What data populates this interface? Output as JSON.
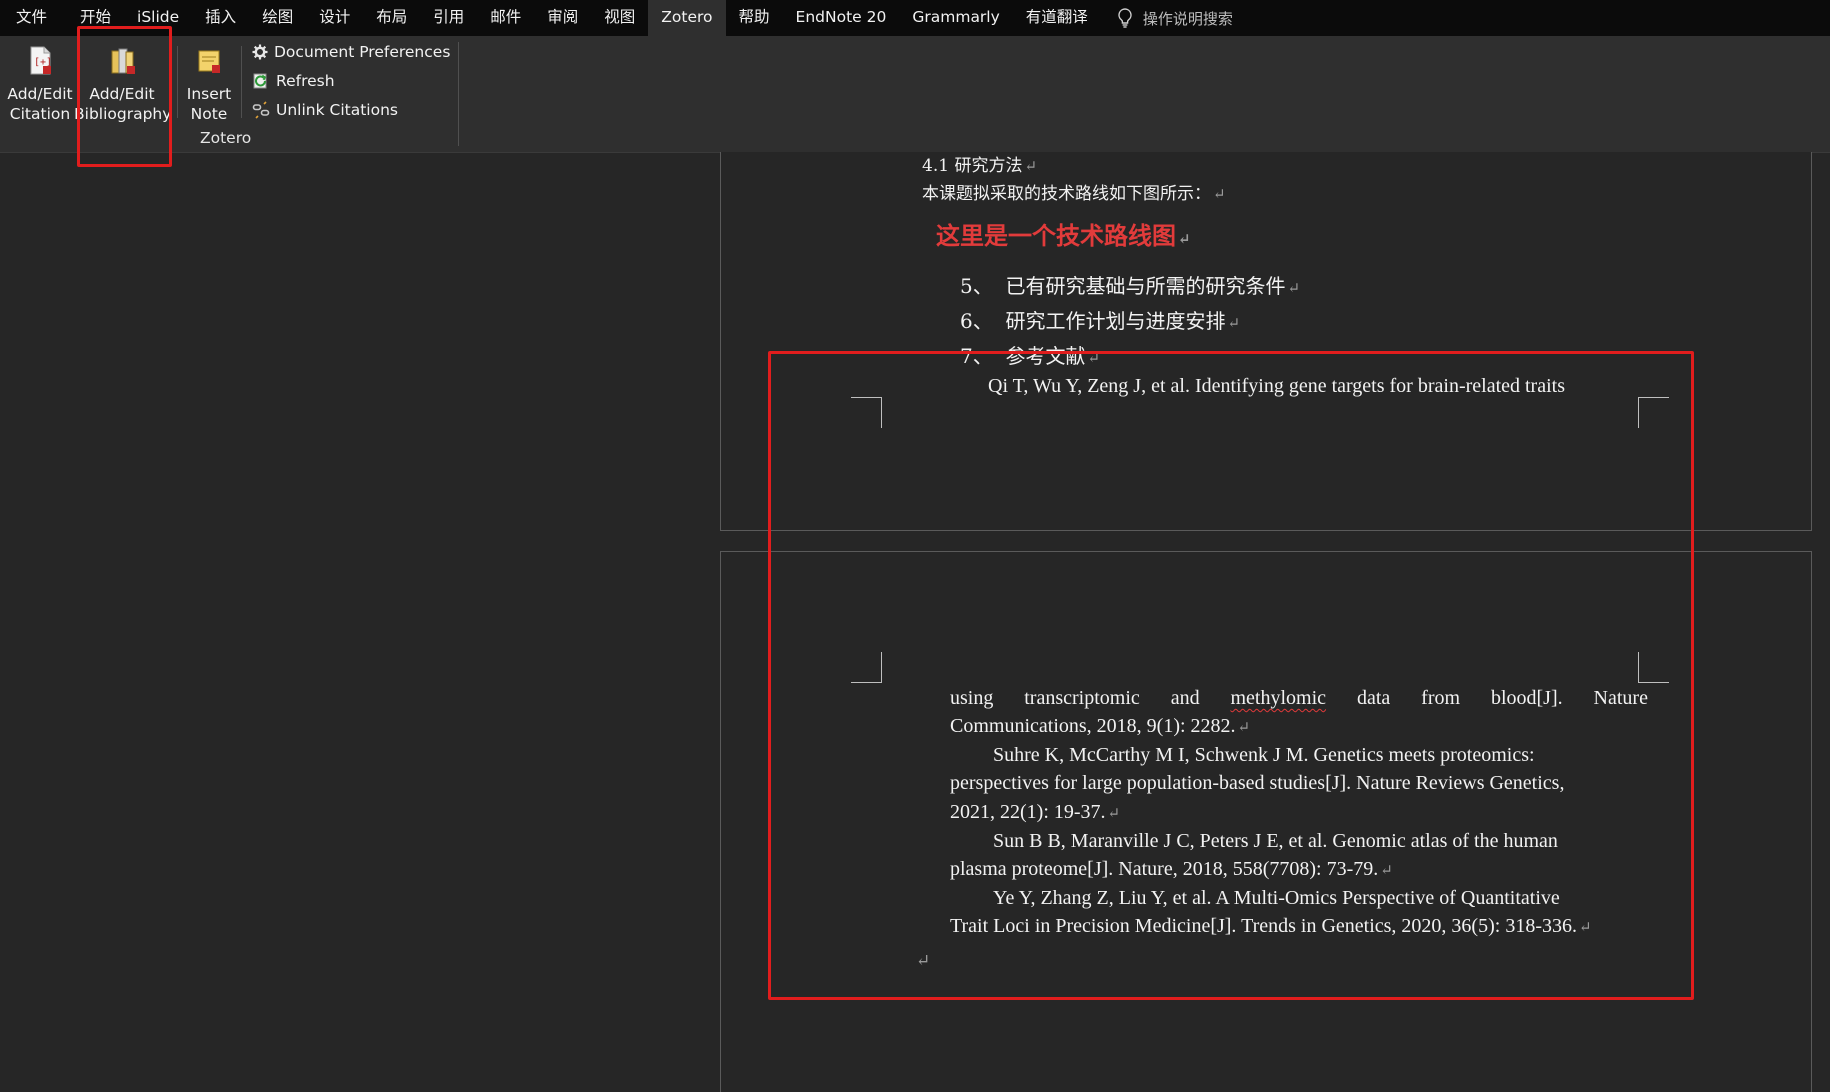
{
  "menu": {
    "tabs": [
      "文件",
      "开始",
      "iSlide",
      "插入",
      "绘图",
      "设计",
      "布局",
      "引用",
      "邮件",
      "审阅",
      "视图",
      "Zotero",
      "帮助",
      "EndNote 20",
      "Grammarly",
      "有道翻译"
    ],
    "active_tab": "Zotero",
    "tell_me": "操作说明搜索"
  },
  "ribbon": {
    "add_edit_citation": [
      "Add/Edit",
      "Citation"
    ],
    "add_edit_bibliography": [
      "Add/Edit",
      "Bibliography"
    ],
    "insert_note": [
      "Insert",
      "Note"
    ],
    "document_preferences": "Document Preferences",
    "refresh": "Refresh",
    "unlink_citations": "Unlink Citations",
    "group_label": "Zotero"
  },
  "document": {
    "heading_41": "4.1 研究方法",
    "route_intro": "本课题拟采取的技术路线如下图所示：",
    "route_placeholder": "这里是一个技术路线图",
    "list": [
      {
        "num": "5、",
        "text": "已有研究基础与所需的研究条件"
      },
      {
        "num": "6、",
        "text": "研究工作计划与进度安排"
      },
      {
        "num": "7、",
        "text": "参考文献"
      }
    ],
    "ref1_line1": "Qi T, Wu Y, Zeng J, et al. Identifying gene targets for brain-related traits",
    "ref1_cont_words": [
      "using",
      "transcriptomic",
      "and",
      "methylomic",
      "data",
      "from",
      "blood[J].",
      "Nature"
    ],
    "ref1_line3": "Communications, 2018, 9(1): 2282.",
    "ref2_line1": "Suhre K, McCarthy M I, Schwenk J M. Genetics meets proteomics:",
    "ref2_line2": "perspectives for large population-based studies[J]. Nature Reviews Genetics,",
    "ref2_line3": "2021, 22(1): 19-37.",
    "ref3_line1": "Sun B B, Maranville J C, Peters J E, et al. Genomic atlas of the human",
    "ref3_line2": "plasma proteome[J]. Nature, 2018, 558(7708): 73-79.",
    "ref4_line1": "Ye Y, Zhang Z, Liu Y, et al. A Multi-Omics Perspective of Quantitative",
    "ref4_line2": "Trait Loci in Precision Medicine[J]. Trends in Genetics, 2020, 36(5): 318-336.",
    "paragraph_mark": "↵"
  },
  "colors": {
    "highlight_box": "#e11d1d",
    "placeholder_text": "#e23b3b",
    "menubar_bg": "#0b0b0b",
    "ribbon_bg": "#2f2f2f",
    "canvas_bg": "#262626"
  }
}
